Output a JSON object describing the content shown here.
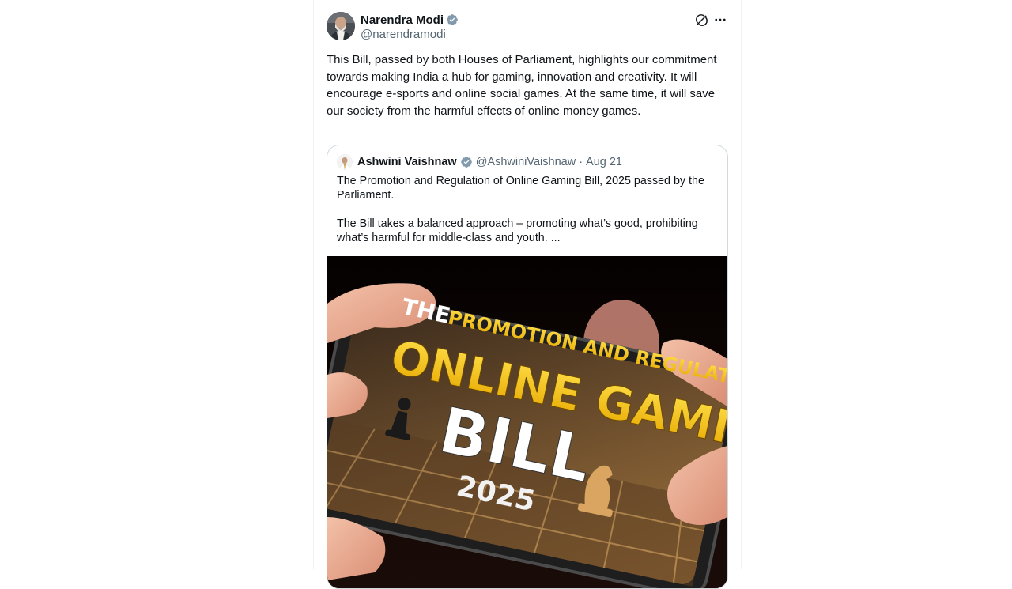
{
  "tweet": {
    "author": {
      "display_name": "Narendra Modi",
      "handle": "@narendramodi",
      "verified": true
    },
    "header_icons": [
      "grok-icon",
      "more-icon"
    ],
    "text": "This Bill, passed by both Houses of Parliament, highlights our commitment towards making India a hub for gaming, innovation and creativity. It will encourage e-sports and online social games. At the same time, it will save our society from the harmful effects of online money games."
  },
  "quote": {
    "author": {
      "display_name": "Ashwini Vaishnaw",
      "handle": "@AshwiniVaishnaw",
      "verified": true
    },
    "separator": "·",
    "date": "Aug 21",
    "paragraph1": "The Promotion and Regulation of Online Gaming Bill, 2025 passed by the Parliament.",
    "paragraph2": "The Bill takes a balanced approach – promoting what’s good, prohibiting what’s harmful for middle-class and youth. ...",
    "media": {
      "line1_a": "THE",
      "line1_b": "PROMOTION AND REGULATION OF",
      "line2": "ONLINE GAMING",
      "line3": "BILL",
      "line4": "2025"
    }
  },
  "colors": {
    "text": "#0f1419",
    "secondary": "#536471",
    "verified": "#829aab",
    "border": "#cfd9de",
    "gold": "#f5c518"
  }
}
